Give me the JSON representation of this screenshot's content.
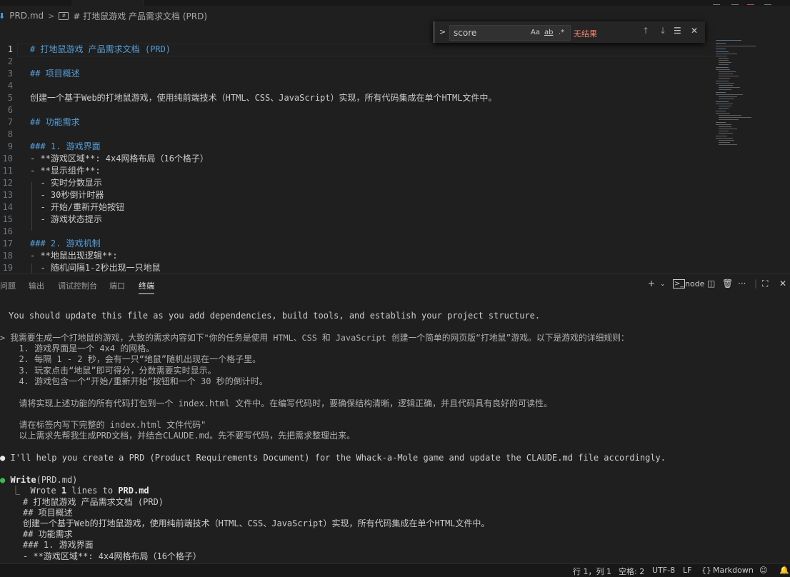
{
  "breadcrumb": {
    "file": "PRD.md",
    "heading": "# 打地鼠游戏 产品需求文档 (PRD)"
  },
  "find": {
    "value": "score",
    "opt_case": "Aa",
    "opt_word": "ab",
    "opt_regex": ".*",
    "no_results": "无结果"
  },
  "editor": {
    "lines": [
      {
        "n": "1",
        "t": "# 打地鼠游戏 产品需求文档 (PRD)"
      },
      {
        "n": "2",
        "t": ""
      },
      {
        "n": "3",
        "t": "## 项目概述"
      },
      {
        "n": "4",
        "t": ""
      },
      {
        "n": "5",
        "t": "创建一个基于Web的打地鼠游戏，使用纯前端技术（HTML、CSS、JavaScript）实现，所有代码集成在单个HTML文件中。"
      },
      {
        "n": "6",
        "t": ""
      },
      {
        "n": "7",
        "t": "## 功能需求"
      },
      {
        "n": "8",
        "t": ""
      },
      {
        "n": "9",
        "t": "### 1. 游戏界面"
      },
      {
        "n": "10",
        "t": "- **游戏区域**: 4x4网格布局（16个格子）"
      },
      {
        "n": "11",
        "t": "- **显示组件**:"
      },
      {
        "n": "12",
        "t": "  - 实时分数显示"
      },
      {
        "n": "13",
        "t": "  - 30秒倒计时器"
      },
      {
        "n": "14",
        "t": "  - 开始/重新开始按钮"
      },
      {
        "n": "15",
        "t": "  - 游戏状态提示"
      },
      {
        "n": "16",
        "t": ""
      },
      {
        "n": "17",
        "t": "### 2. 游戏机制"
      },
      {
        "n": "18",
        "t": "- **地鼠出现逻辑**:"
      },
      {
        "n": "19",
        "t": "  - 随机间隔1-2秒出现一只地鼠"
      }
    ]
  },
  "panel": {
    "tabs": [
      "问题",
      "输出",
      "调试控制台",
      "端口",
      "终端"
    ],
    "active_tab": "终端",
    "shell": "node"
  },
  "terminal": {
    "lines": [
      "You should update this file as you add dependencies, build tools, and establish your project structure.",
      "> 我需要生成一个打地鼠的游戏，大致的需求内容如下\"你的任务是使用 HTML、CSS 和 JavaScript 创建一个简单的网页版“打地鼠”游戏。以下是游戏的详细规则：",
      "  1. 游戏界面是一个 4x4 的网格。",
      "  2. 每隔 1 - 2 秒，会有一只“地鼠”随机出现在一个格子里。",
      "  3. 玩家点击“地鼠”即可得分，分数需要实时显示。",
      "  4. 游戏包含一个“开始/重新开始”按钮和一个 30 秒的倒计时。",
      "  请将实现上述功能的所有代码打包到一个 index.html 文件中。在编写代码时，要确保结构清晰，逻辑正确，并且代码具有良好的可读性。",
      "  请在标签内写下完整的 index.html 文件代码\"",
      "  以上需求先帮我生成PRD文档，并结合CLAUDE.md。先不要写代码，先把需求整理出来。",
      "I'll help you create a PRD (Product Requirements Document) for the Whack-a-Mole game and update the CLAUDE.md file accordingly.",
      "Write",
      "(PRD.md)",
      "Wrote ",
      "1",
      " lines to ",
      "PRD.md",
      "# 打地鼠游戏 产品需求文档 (PRD)",
      "## 项目概述",
      "创建一个基于Web的打地鼠游戏，使用纯前端技术（HTML、CSS、JavaScript）实现，所有代码集成在单个HTML文件中。",
      "## 功能需求",
      "### 1. 游戏界面",
      "- **游戏区域**: 4x4网格布局（16个格子）"
    ]
  },
  "status": {
    "position": "行 1，列 1",
    "spaces": "空格: 2",
    "encoding": "UTF-8",
    "eol": "LF",
    "language": "Markdown"
  }
}
